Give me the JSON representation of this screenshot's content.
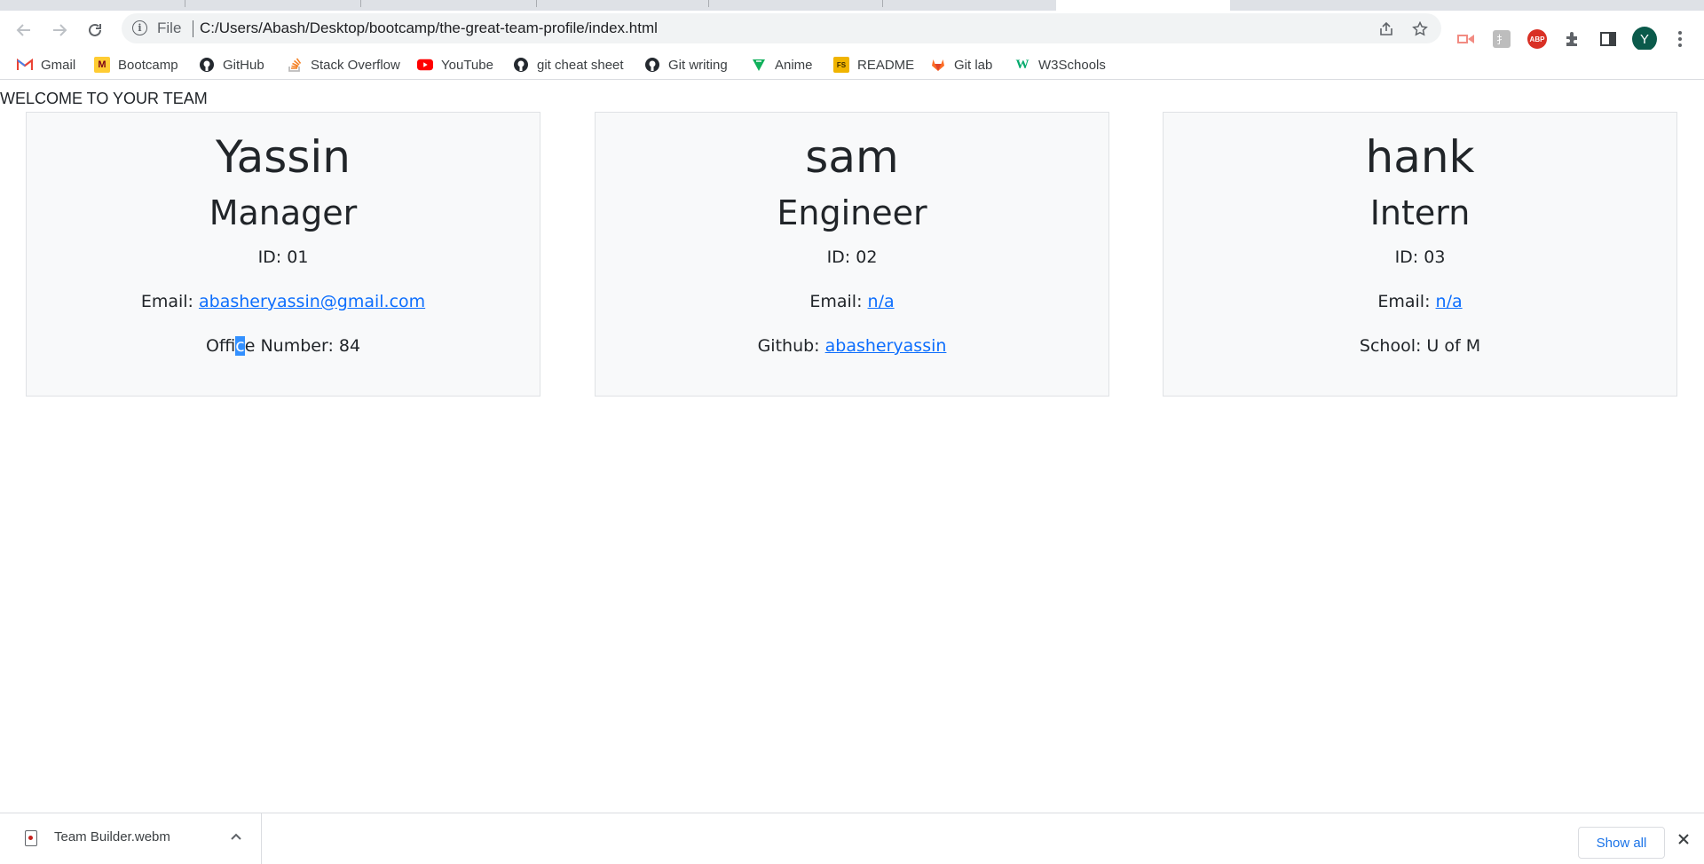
{
  "browser": {
    "omnibox": {
      "scheme_label": "File",
      "url": "C:/Users/Abash/Desktop/bootcamp/the-great-team-profile/index.html"
    },
    "profile_initial": "Y"
  },
  "bookmarks": [
    {
      "label": "Gmail",
      "icon": "gmail-icon"
    },
    {
      "label": "Bootcamp",
      "icon": "bootcamp-icon"
    },
    {
      "label": "GitHub",
      "icon": "github-icon"
    },
    {
      "label": "Stack Overflow",
      "icon": "stackoverflow-icon"
    },
    {
      "label": "YouTube",
      "icon": "youtube-icon"
    },
    {
      "label": "git cheat sheet",
      "icon": "github-icon"
    },
    {
      "label": "Git writing",
      "icon": "github-icon"
    },
    {
      "label": "Anime",
      "icon": "anime-icon"
    },
    {
      "label": "README",
      "icon": "readme-icon"
    },
    {
      "label": "Git lab",
      "icon": "gitlab-icon"
    },
    {
      "label": "W3Schools",
      "icon": "w3schools-icon"
    }
  ],
  "page": {
    "heading": "WELCOME TO YOUR TEAM",
    "cards": [
      {
        "name": "Yassin",
        "role": "Manager",
        "id": "ID: 01",
        "email_prefix": "Email: ",
        "email": "abasheryassin@gmail.com",
        "extra_prefix_a": "Offi",
        "extra_selected": "c",
        "extra_prefix_b": "e Number: 84"
      },
      {
        "name": "sam",
        "role": "Engineer",
        "id": "ID: 02",
        "email_prefix": "Email: ",
        "email": "n/a",
        "extra_label": "Github: ",
        "extra_link": "abasheryassin"
      },
      {
        "name": "hank",
        "role": "Intern",
        "id": "ID: 03",
        "email_prefix": "Email: ",
        "email": "n/a",
        "extra_text": "School: U of M"
      }
    ]
  },
  "downloads": {
    "file_name": "Team Builder.webm",
    "show_all_label": "Show all"
  },
  "colors": {
    "link": "#0d6efd",
    "card_bg": "#f8f9fa",
    "selection": "#3390ff"
  }
}
